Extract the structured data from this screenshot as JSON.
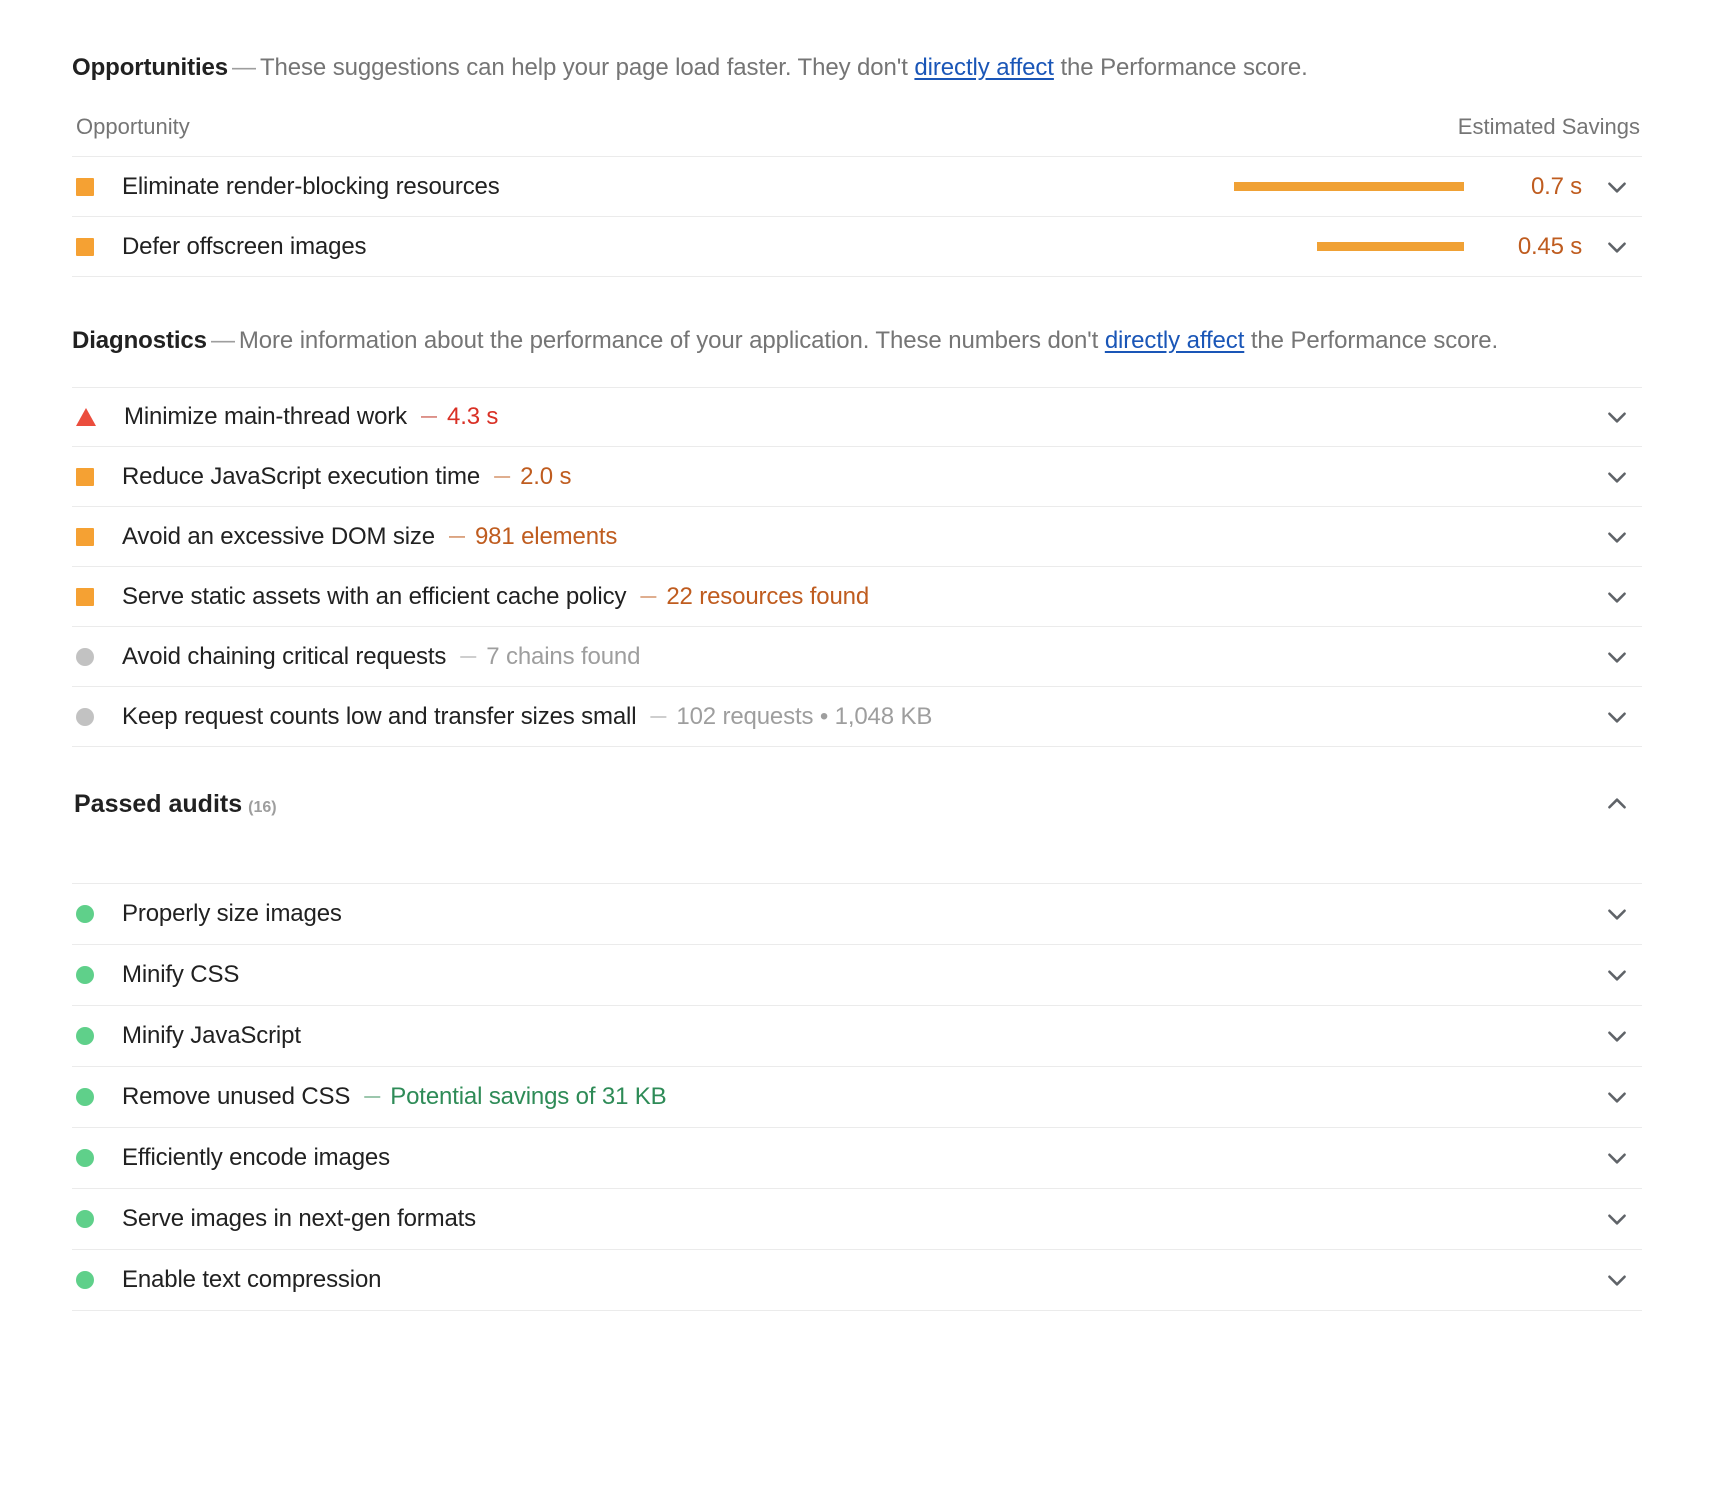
{
  "opportunities": {
    "section_label": "Opportunities",
    "dash": "—",
    "description_before_link": "These suggestions can help your page load faster. They don't ",
    "link_text": "directly affect",
    "description_after_link": " the Performance score.",
    "column_headers": {
      "opportunity": "Opportunity",
      "estimated_savings": "Estimated Savings"
    },
    "rows": [
      {
        "marker": "square-orange-icon",
        "title": "Eliminate render-blocking resources",
        "savings": "0.7 s",
        "bar_pct": 100,
        "chevron": "chevron-down-icon"
      },
      {
        "marker": "square-orange-icon",
        "title": "Defer offscreen images",
        "savings": "0.45 s",
        "bar_pct": 64,
        "chevron": "chevron-down-icon"
      }
    ]
  },
  "diagnostics": {
    "section_label": "Diagnostics",
    "dash": "—",
    "description_before_link": "More information about the performance of your application. These numbers don't ",
    "link_text": "directly affect",
    "description_after_link": " the Performance score.",
    "rows": [
      {
        "marker": "triangle-red-icon",
        "title": "Minimize main-thread work",
        "dash": "—",
        "value": "4.3 s",
        "value_tone": "red",
        "chevron": "chevron-down-icon"
      },
      {
        "marker": "square-orange-icon",
        "title": "Reduce JavaScript execution time",
        "dash": "—",
        "value": "2.0 s",
        "value_tone": "orange",
        "chevron": "chevron-down-icon"
      },
      {
        "marker": "square-orange-icon",
        "title": "Avoid an excessive DOM size",
        "dash": "—",
        "value": "981 elements",
        "value_tone": "orange",
        "chevron": "chevron-down-icon"
      },
      {
        "marker": "square-orange-icon",
        "title": "Serve static assets with an efficient cache policy",
        "dash": "—",
        "value": "22 resources found",
        "value_tone": "orange",
        "chevron": "chevron-down-icon"
      },
      {
        "marker": "circle-gray-icon",
        "title": "Avoid chaining critical requests",
        "dash": "—",
        "value": "7 chains found",
        "value_tone": "gray",
        "chevron": "chevron-down-icon"
      },
      {
        "marker": "circle-gray-icon",
        "title": "Keep request counts low and transfer sizes small",
        "dash": "—",
        "value": "102 requests • 1,048 KB",
        "value_tone": "gray",
        "chevron": "chevron-down-icon"
      }
    ]
  },
  "passed_audits": {
    "title": "Passed audits",
    "count": "(16)",
    "toggle_icon": "chevron-up-icon",
    "expanded": true,
    "rows": [
      {
        "marker": "circle-green-icon",
        "title": "Properly size images",
        "dash": "",
        "value": "",
        "chevron": "chevron-down-icon"
      },
      {
        "marker": "circle-green-icon",
        "title": "Minify CSS",
        "dash": "",
        "value": "",
        "chevron": "chevron-down-icon"
      },
      {
        "marker": "circle-green-icon",
        "title": "Minify JavaScript",
        "dash": "",
        "value": "",
        "chevron": "chevron-down-icon"
      },
      {
        "marker": "circle-green-icon",
        "title": "Remove unused CSS",
        "dash": "—",
        "value": "Potential savings of 31 KB",
        "value_tone": "green",
        "chevron": "chevron-down-icon"
      },
      {
        "marker": "circle-green-icon",
        "title": "Efficiently encode images",
        "dash": "",
        "value": "",
        "chevron": "chevron-down-icon"
      },
      {
        "marker": "circle-green-icon",
        "title": "Serve images in next-gen formats",
        "dash": "",
        "value": "",
        "chevron": "chevron-down-icon"
      },
      {
        "marker": "circle-green-icon",
        "title": "Enable text compression",
        "dash": "",
        "value": "",
        "chevron": "chevron-down-icon"
      }
    ]
  },
  "colors": {
    "orange_marker": "#f5a133",
    "green_marker": "#5fd08a",
    "gray_marker": "#c2c2c2",
    "red_triangle": "#eb4d3d",
    "bar_fill": "#f0a135",
    "savings_text": "#bf5c1f",
    "link": "#1a56b7",
    "body_text": "#212121",
    "muted_text": "#757575",
    "divider": "#ebebeb"
  }
}
